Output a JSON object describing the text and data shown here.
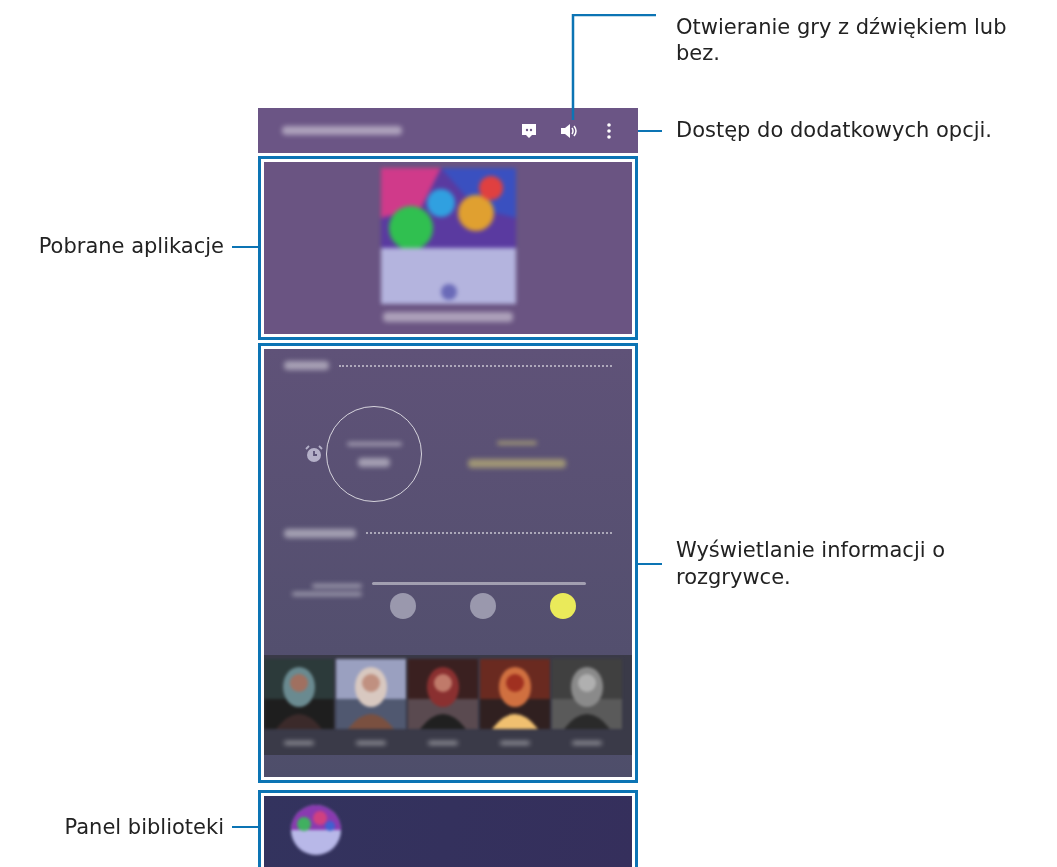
{
  "callouts": {
    "sound": "Otwieranie gry z dźwiękiem lub bez.",
    "options": "Dostęp do dodatkowych opcji.",
    "apps": "Pobrane aplikacje",
    "info": "Wyświetlanie informacji o rozgrywce.",
    "library": "Panel biblioteki"
  },
  "performance_options": [
    {
      "selected": false
    },
    {
      "selected": false
    },
    {
      "selected": true
    }
  ]
}
